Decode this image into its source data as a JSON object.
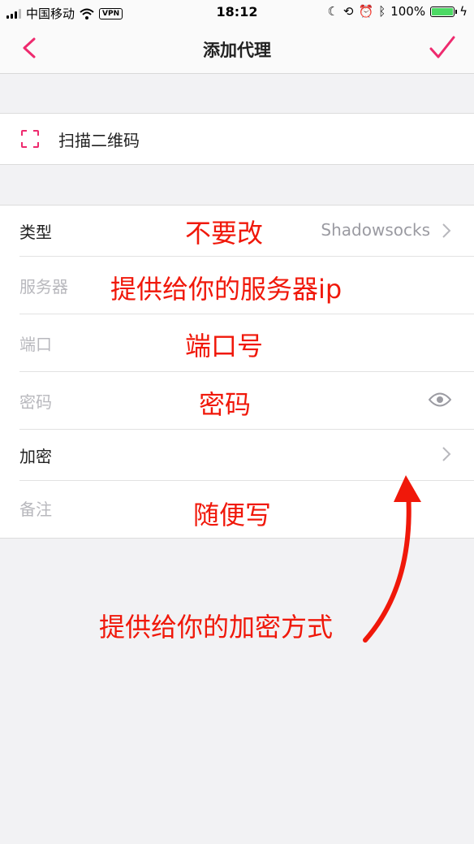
{
  "status_bar": {
    "carrier": "中国移动",
    "vpn": "VPN",
    "time": "18:12",
    "battery": "100%",
    "battery_level": 1.0
  },
  "nav": {
    "title": "添加代理",
    "accent": "#ee2a6e"
  },
  "scan": {
    "label": "扫描二维码"
  },
  "form": {
    "rows": [
      {
        "label": "类型",
        "value": "Shadowsocks"
      },
      {
        "label": "服务器"
      },
      {
        "label": "端口"
      },
      {
        "label": "密码"
      },
      {
        "label": "加密"
      },
      {
        "label": "备注"
      }
    ]
  },
  "annotations": {
    "type": "不要改",
    "server": "提供给你的服务器ip",
    "port": "端口号",
    "password": "密码",
    "note": "随便写",
    "encryption": "提供给你的加密方式",
    "color": "#f0180a"
  }
}
